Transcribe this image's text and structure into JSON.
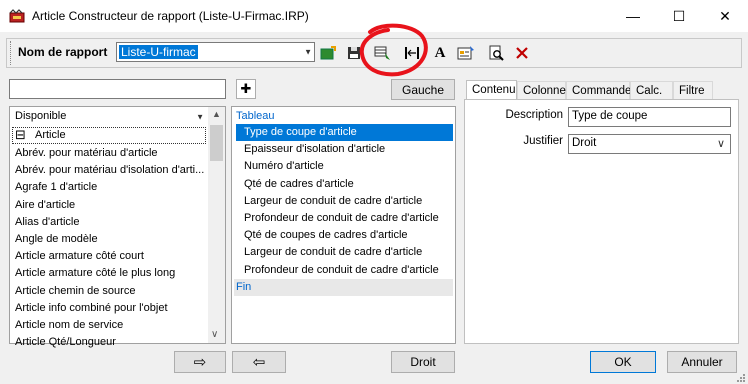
{
  "window": {
    "title": "Article Constructeur de rapport (Liste-U-Firmac.IRP)",
    "minimize": "—",
    "maximize": "☐",
    "close": "✕"
  },
  "toolbar": {
    "report_name_label": "Nom de rapport",
    "report_name_value": "Liste-U-firmac",
    "icons": [
      "new-report-icon",
      "save-icon",
      "layout-icon",
      "spacing-icon",
      "font-icon",
      "properties-icon",
      "preview-icon",
      "delete-icon"
    ]
  },
  "left": {
    "search_value": "",
    "filter_value": "Disponible",
    "group_label": "Article",
    "group_toggle": "⊟",
    "items": [
      "Abrév. pour matériau d'article",
      "Abrév. pour matériau d'isolation d'arti...",
      "Agrafe 1 d'article",
      "Aire d'article",
      "Alias d'article",
      "Angle de modèle",
      "Article armature côté court",
      "Article armature côté le plus long",
      "Article chemin de source",
      "Article info combiné pour l'objet",
      "Article nom de service",
      "Article Qté/Longueur"
    ]
  },
  "middle": {
    "add_button": "✚",
    "left_button": "Gauche",
    "header": "Tableau",
    "items": [
      "Type de coupe d'article",
      "Epaisseur d'isolation d'article",
      "Numéro d'article",
      "Qté de cadres d'article",
      "Largeur de conduit de cadre d'article",
      "Profondeur de conduit de cadre d'article",
      "Qté de coupes de cadres d'article",
      "Largeur de conduit de cadre d'article",
      "Profondeur de conduit de cadre d'article"
    ],
    "selected_index": 0,
    "footer": "Fin"
  },
  "tabs": [
    "Contenu",
    "Colonne",
    "Commande",
    "Calc.",
    "Filtre"
  ],
  "props": {
    "description_label": "Description",
    "description_value": "Type de coupe",
    "justify_label": "Justifier",
    "justify_value": "Droit"
  },
  "bottom": {
    "move_right": "⇨",
    "move_left": "⇦",
    "align_button": "Droit",
    "ok": "OK",
    "cancel": "Annuler"
  },
  "colors": {
    "selection": "#0078d7",
    "header_blue": "#0066cc",
    "annotation_red": "#e8131b",
    "delete_red": "#c00000"
  }
}
